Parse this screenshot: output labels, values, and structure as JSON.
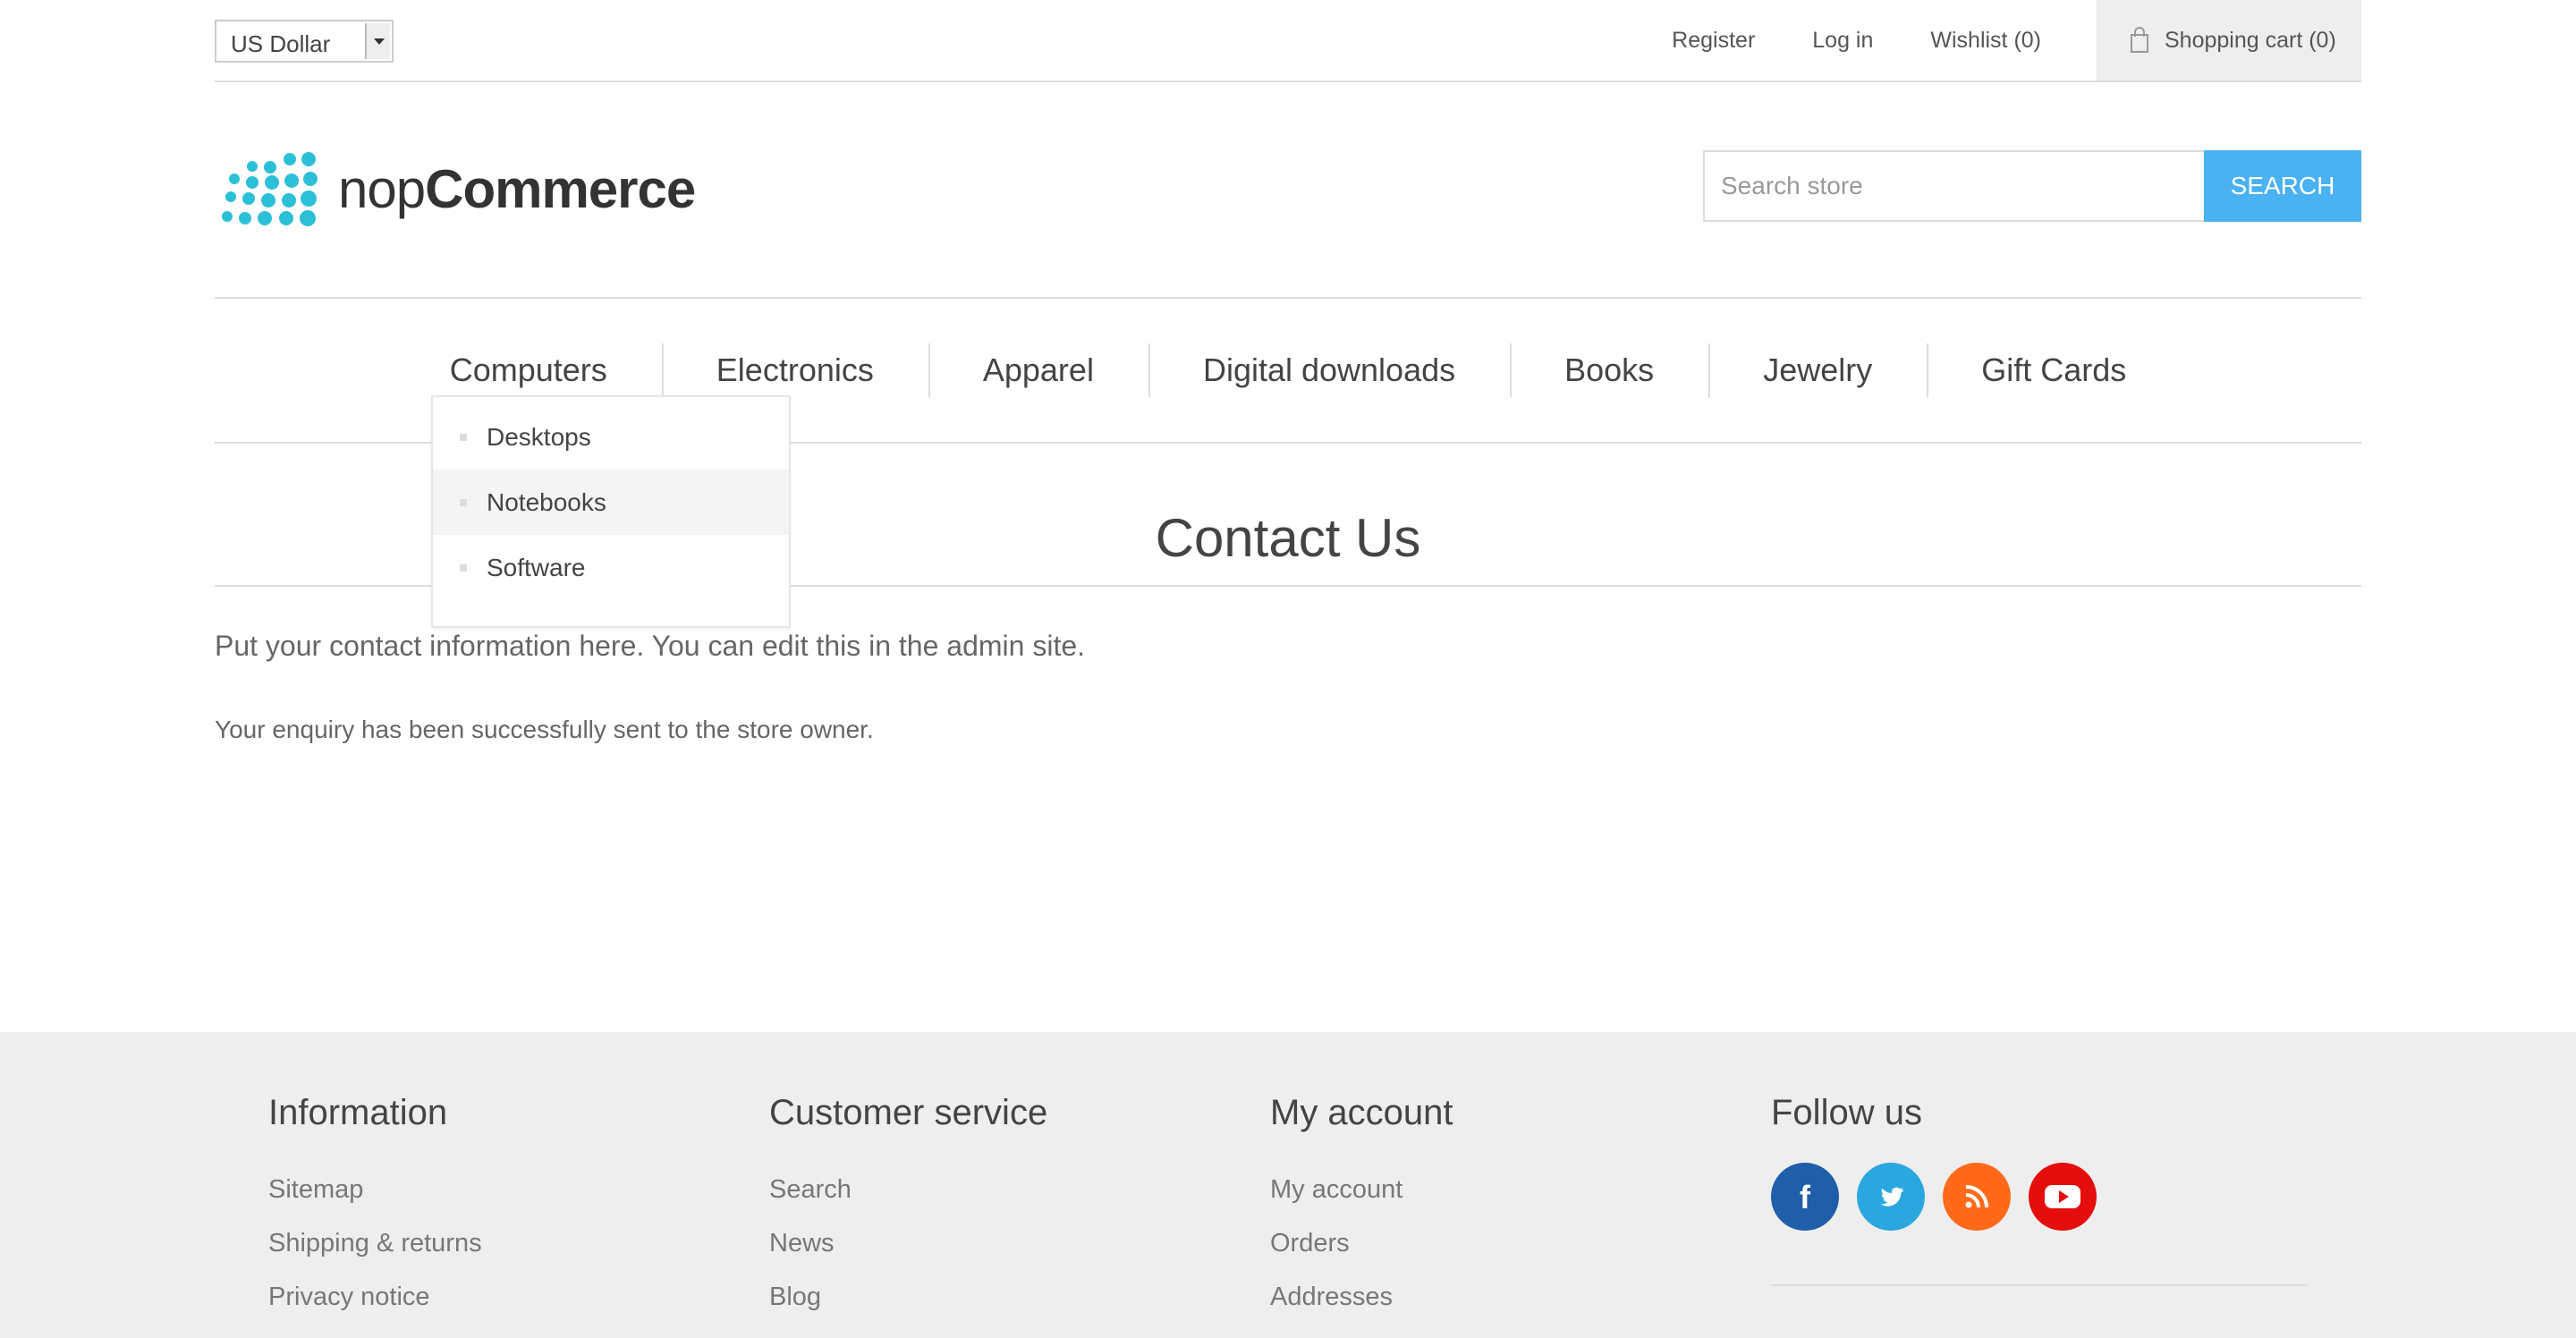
{
  "header": {
    "currency": "US Dollar",
    "links": {
      "register": "Register",
      "login": "Log in",
      "wishlist": "Wishlist (0)",
      "cart": "Shopping cart (0)"
    }
  },
  "logo": {
    "prefix": "nop",
    "suffix": "Commerce"
  },
  "search": {
    "placeholder": "Search store",
    "button": "SEARCH"
  },
  "menu": {
    "items": [
      "Computers",
      "Electronics",
      "Apparel",
      "Digital downloads",
      "Books",
      "Jewelry",
      "Gift Cards"
    ],
    "submenu": [
      "Desktops",
      "Notebooks",
      "Software"
    ]
  },
  "content": {
    "title": "Contact Us",
    "topic": "Put your contact information here. You can edit this in the admin site.",
    "result": "Your enquiry has been successfully sent to the store owner."
  },
  "footer": {
    "information": {
      "title": "Information",
      "links": [
        "Sitemap",
        "Shipping & returns",
        "Privacy notice"
      ]
    },
    "customer_service": {
      "title": "Customer service",
      "links": [
        "Search",
        "News",
        "Blog"
      ]
    },
    "my_account": {
      "title": "My account",
      "links": [
        "My account",
        "Orders",
        "Addresses"
      ]
    },
    "follow_us": {
      "title": "Follow us"
    }
  },
  "colors": {
    "accent": "#4ab2f1",
    "logo": "#2bc0d8",
    "facebook": "#1f5ea8",
    "twitter": "#2ba7e0",
    "rss": "#ff6a1a",
    "youtube": "#e60d0d"
  },
  "icons": [
    "dropdown-arrow-icon",
    "shopping-bag-icon",
    "facebook-icon",
    "twitter-icon",
    "rss-icon",
    "youtube-icon"
  ]
}
